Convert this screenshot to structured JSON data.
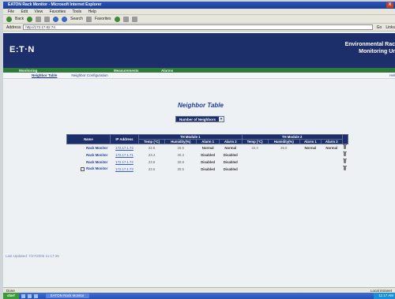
{
  "window": {
    "title": "EATON Rack Monitor - Microsoft Internet Explorer",
    "close_label": "X"
  },
  "menu": [
    "File",
    "Edit",
    "View",
    "Favorites",
    "Tools",
    "Help"
  ],
  "toolbar": {
    "back_label": "Back",
    "search_label": "Search",
    "favorites_label": "Favorites"
  },
  "address": {
    "label": "Address",
    "url": "http://172.17.62.74",
    "go_label": "Go",
    "links_label": "Links"
  },
  "banner": {
    "logo": "E:T·N",
    "title_line1": "Environmental Rac",
    "title_line2": "Monitoring Ur"
  },
  "nav": {
    "items": [
      "Monitoring",
      "Measurements",
      "Alarms"
    ]
  },
  "subnav": {
    "items": [
      "Neighbor Table",
      "Neighbor Configuration"
    ],
    "right": "Hel"
  },
  "page": {
    "heading": "Neighbor Table",
    "selector_label": "Number of Neighbors",
    "last_update": "Last Updated: 7/27/2005 11:17:45"
  },
  "table": {
    "headers": {
      "name": "Name",
      "ip": "IP Address",
      "group1": "TH Module 1",
      "group2": "TH Module 2",
      "sub": [
        "Temp (°C)",
        "Humidity(%)",
        "Alarm 1",
        "Alarm 2",
        "Temp (°C)",
        "Humidity(%)",
        "Alarm 1",
        "Alarm 2"
      ]
    },
    "rows": [
      {
        "name": "Rack Monitor",
        "ip": "172.17.1.74",
        "cells": [
          "22.6",
          "25.6",
          "Normal",
          "Normal",
          "22.3",
          "26.0",
          "Normal",
          "Normal"
        ],
        "flag": false
      },
      {
        "name": "Rack Monitor",
        "ip": "172.17.1.71",
        "cells": [
          "23.4",
          "30.3",
          "Disabled",
          "Disabled",
          "",
          "",
          "",
          ""
        ],
        "flag": false
      },
      {
        "name": "Rack Monitor",
        "ip": "172.17.1.72",
        "cells": [
          "23.8",
          "30.8",
          "Disabled",
          "Disabled",
          "",
          "",
          "",
          ""
        ],
        "flag": false
      },
      {
        "name": "Rack Monitor",
        "ip": "172.17.1.73",
        "cells": [
          "23.6",
          "30.5",
          "Disabled",
          "Disabled",
          "",
          "",
          "",
          ""
        ],
        "flag": true
      }
    ]
  },
  "statusbar": {
    "left": "Done",
    "right": "Local intranet"
  },
  "taskbar": {
    "start": "start",
    "task": "EATON Rack Monitor",
    "clock": "11:17 AM"
  }
}
